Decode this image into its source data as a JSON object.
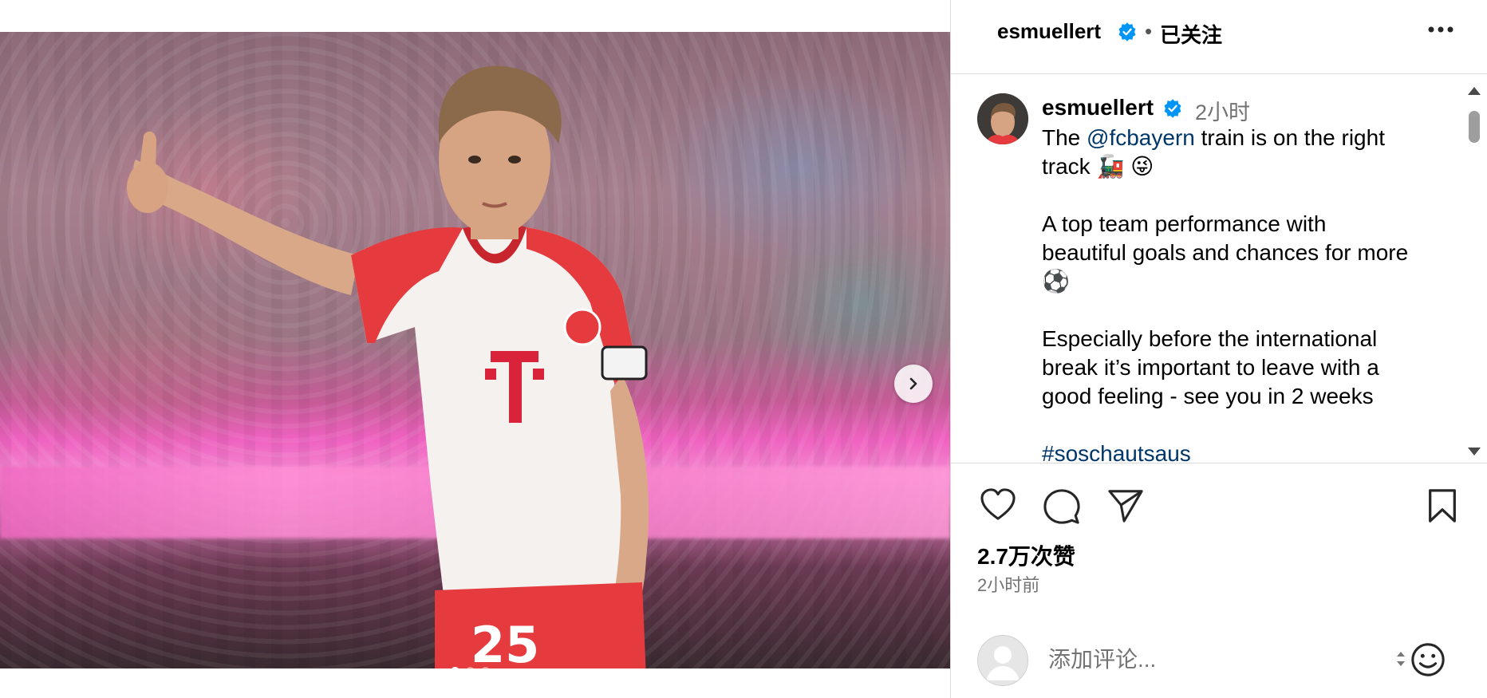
{
  "media": {
    "player_number": "25",
    "image_dots": [
      true,
      false,
      false
    ]
  },
  "header": {
    "username": "esmuellert",
    "separator": "•",
    "follow_status": "已关注"
  },
  "caption": {
    "username": "esmuellert",
    "time": "2小时",
    "line1_prefix": "The ",
    "line1_mention": "@fcbayern",
    "line1_suffix": " train is on the right",
    "line2": "track 🚂 😜",
    "para2_line1": "A top team performance with",
    "para2_line2": "beautiful goals and chances for more",
    "para2_line3": "⚽",
    "para3_line1": "Especially before the international",
    "para3_line2": "break it’s important to leave with a",
    "para3_line3": "good feeling - see you in 2 weeks",
    "hashtag": "#soschautsaus"
  },
  "stats": {
    "likes": "2.7万次赞",
    "posted": "2小时前"
  },
  "comment": {
    "placeholder": "添加评论..."
  },
  "icons": {
    "verified": "verified-badge-icon",
    "more": "more-options-icon",
    "like": "heart-icon",
    "comment": "comment-bubble-icon",
    "share": "paper-plane-icon",
    "save": "bookmark-icon",
    "next": "chevron-right-icon",
    "emoji": "smiley-icon"
  },
  "colors": {
    "verified_blue": "#0095f6",
    "link": "#00376b",
    "muted": "#737373",
    "border": "#dbdbdb"
  }
}
